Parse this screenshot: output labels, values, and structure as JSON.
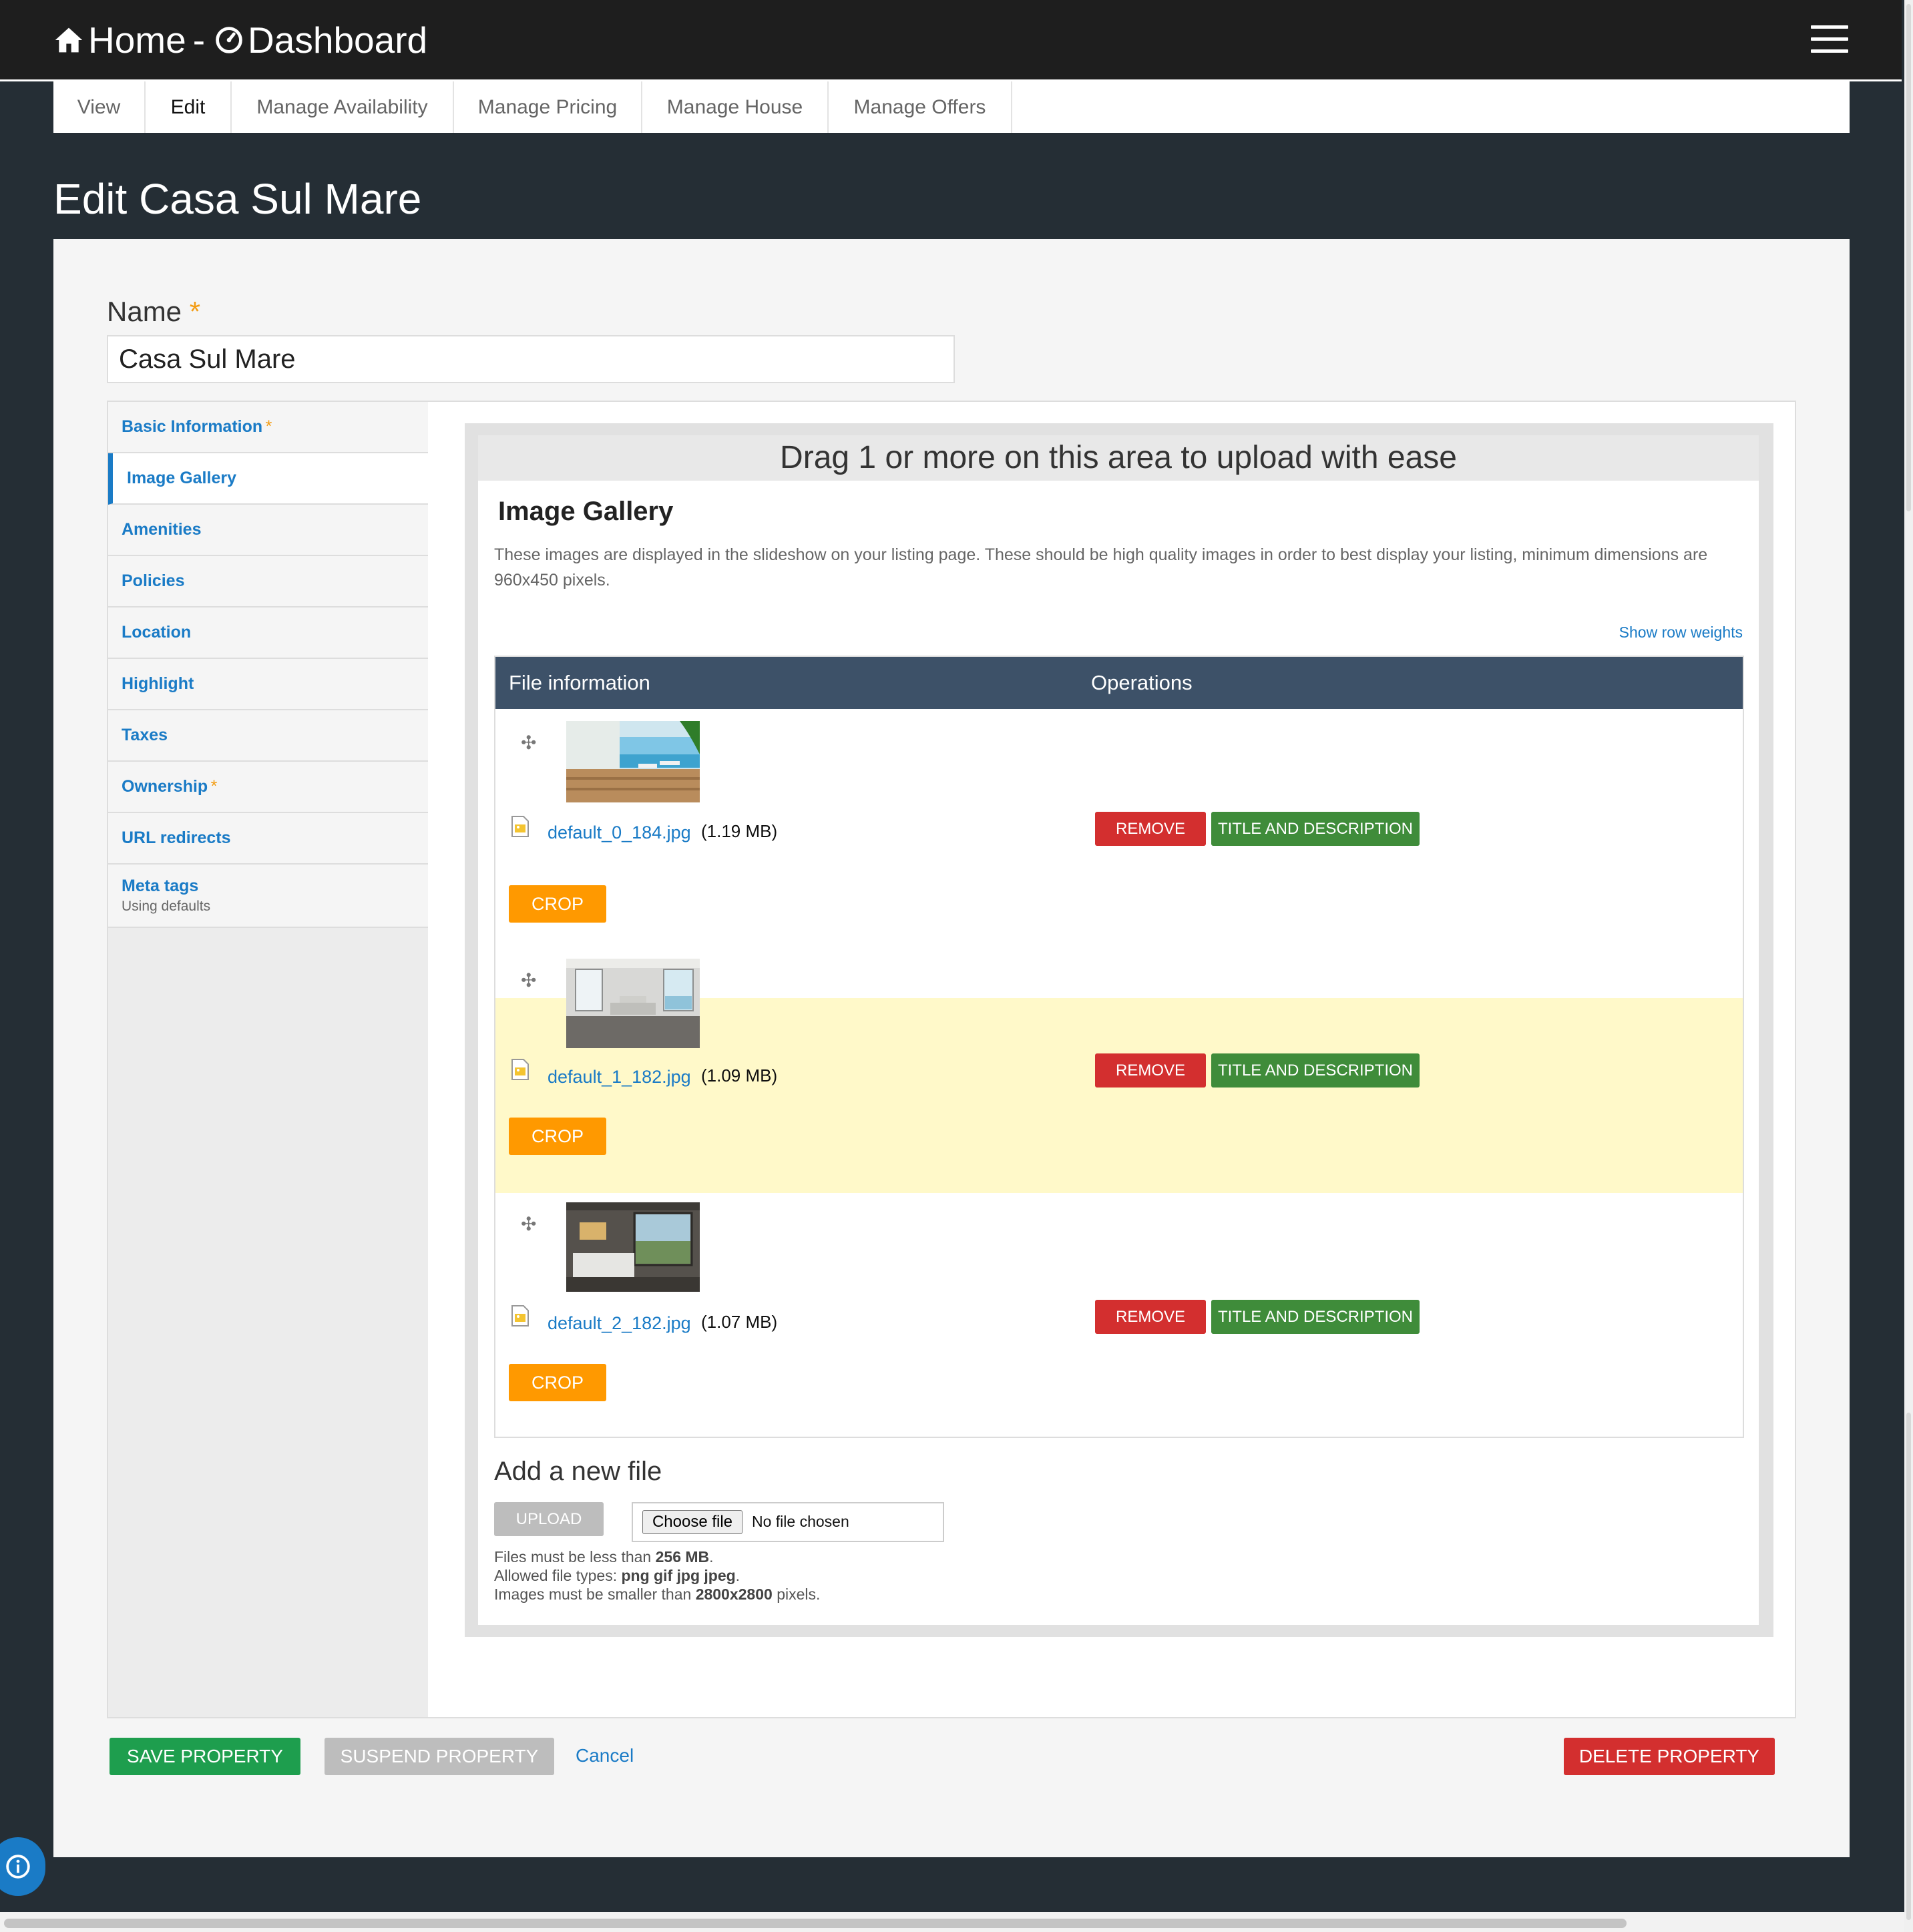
{
  "header": {
    "home_label": "Home",
    "separator": "-",
    "dashboard_label": "Dashboard"
  },
  "tabs": [
    {
      "label": "View"
    },
    {
      "label": "Edit"
    },
    {
      "label": "Manage Availability"
    },
    {
      "label": "Manage Pricing"
    },
    {
      "label": "Manage House"
    },
    {
      "label": "Manage Offers"
    }
  ],
  "active_tab": "Edit",
  "page_title": "Edit Casa Sul Mare",
  "name_field": {
    "label": "Name",
    "required_marker": "*",
    "value": "Casa Sul Mare"
  },
  "vertical_tabs": [
    {
      "label": "Basic Information",
      "required": "*"
    },
    {
      "label": "Image Gallery"
    },
    {
      "label": "Amenities"
    },
    {
      "label": "Policies"
    },
    {
      "label": "Location"
    },
    {
      "label": "Highlight"
    },
    {
      "label": "Taxes"
    },
    {
      "label": "Ownership",
      "required": "*"
    },
    {
      "label": "URL redirects"
    },
    {
      "label": "Meta tags",
      "summary": "Using defaults"
    }
  ],
  "gallery": {
    "dropzone_text": "Drag 1 or more on this area to upload with ease",
    "title": "Image Gallery",
    "description": "These images are displayed in the slideshow on your listing page. These should be high quality images in order to best display your listing, minimum dimensions are 960x450 pixels.",
    "show_row_weights": "Show row weights",
    "columns": [
      "File information",
      "Operations"
    ],
    "files": [
      {
        "name": "default_0_184.jpg",
        "size": "(1.19 MB)",
        "crop": "CROP",
        "remove": "REMOVE",
        "title_desc": "TITLE AND DESCRIPTION"
      },
      {
        "name": "default_1_182.jpg",
        "size": "(1.09 MB)",
        "crop": "CROP",
        "remove": "REMOVE",
        "title_desc": "TITLE AND DESCRIPTION"
      },
      {
        "name": "default_2_182.jpg",
        "size": "(1.07 MB)",
        "crop": "CROP",
        "remove": "REMOVE",
        "title_desc": "TITLE AND DESCRIPTION"
      }
    ],
    "add_file": {
      "title": "Add a new file",
      "upload_label": "UPLOAD",
      "choose_label": "Choose file",
      "no_file": "No file chosen",
      "help": {
        "size_prefix": "Files must be less than ",
        "size_value": "256 MB",
        "size_suffix": ".",
        "types_prefix": "Allowed file types: ",
        "types_value": "png gif jpg jpeg",
        "types_suffix": ".",
        "dims_prefix": "Images must be smaller than ",
        "dims_value": "2800x2800",
        "dims_suffix": " pixels."
      }
    }
  },
  "actions": {
    "save": "SAVE PROPERTY",
    "suspend": "SUSPEND PROPERTY",
    "cancel": "Cancel",
    "delete": "DELETE PROPERTY"
  },
  "colors": {
    "accent_blue": "#1a7bc6",
    "table_header": "#3d5168",
    "remove_red": "#d32f2f",
    "title_green": "#3f8c3a",
    "crop_orange": "#ff9900",
    "save_green": "#1e9e4e",
    "highlight_row": "#fff9c9"
  }
}
